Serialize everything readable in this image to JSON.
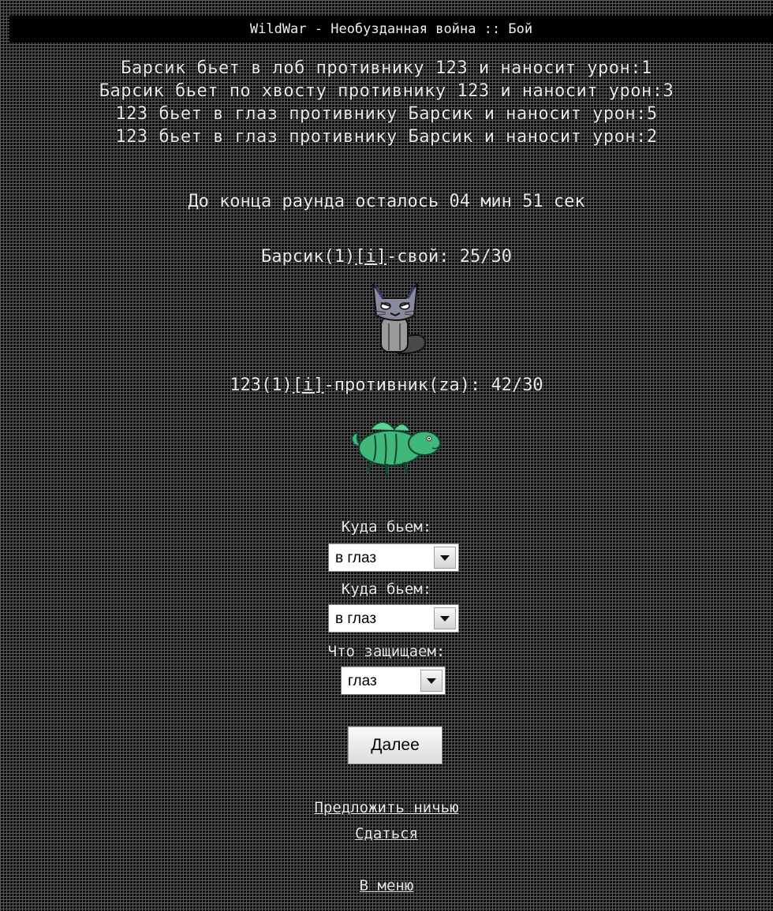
{
  "window": {
    "title": "WildWar - Необузданная война :: Бой"
  },
  "battle_log": [
    "Барсик бьет в лоб противнику 123 и наносит урон:1",
    "Барсик бьет по хвосту противнику 123 и наносит урон:3",
    "123 бьет в глаз противнику Барсик и наносит урон:5",
    "123 бьет в глаз противнику Барсик и наносит урон:2"
  ],
  "timer": "До конца раунда осталось 04 мин 51 сек",
  "player": {
    "name_level": "Барсик(1)",
    "info_link": "[i]",
    "status": "-свой: 25/30",
    "avatar_icon": "gray-cat-icon"
  },
  "enemy": {
    "name_level": "123(1)",
    "info_link": "[i]",
    "status": "-противник(za): 42/30",
    "avatar_icon": "green-dragon-icon"
  },
  "form": {
    "attack1": {
      "label": "Куда бьем:",
      "value": "в глаз"
    },
    "attack2": {
      "label": "Куда бьем:",
      "value": "в глаз"
    },
    "defense": {
      "label": "Что защищаем:",
      "value": "глаз"
    },
    "next_button": "Далее"
  },
  "links": {
    "offer_draw": "Предложить ничью",
    "surrender": "Сдаться",
    "to_menu": "В меню"
  },
  "colors": {
    "background": "#0d0d0d",
    "grid": "#5a5a5a",
    "text": "#e8e8e8",
    "dragon": "#3fb87a"
  }
}
